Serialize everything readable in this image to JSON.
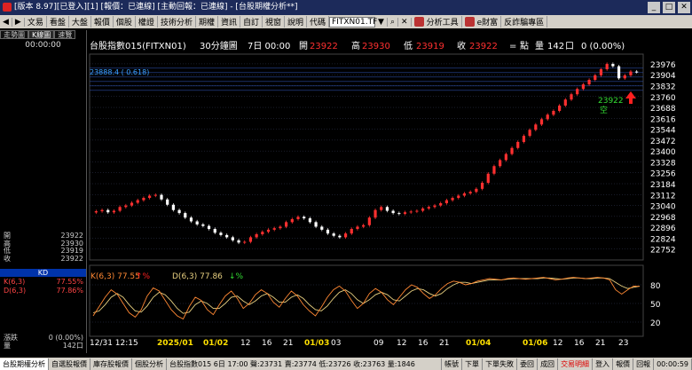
{
  "window": {
    "title": "[版本 8.97][已登入][1] [報價：已連線] [主動回報：已連線] - [台股期權分析**]"
  },
  "menu": {
    "items": [
      "文易",
      "看盤",
      "大盤",
      "報價",
      "個股",
      "權證",
      "技術分析",
      "期權",
      "資訊",
      "自訂",
      "視窗",
      "說明"
    ],
    "code_label": "代碼",
    "code_value": "FITXN01.TF",
    "tools": "分析工具",
    "ipro": "e財富",
    "rebate": "反詐騙專區"
  },
  "left": {
    "tabs": [
      "走勢圖",
      "K線圖",
      "速覽"
    ],
    "time": "00:00:00",
    "ohlc": [
      {
        "l": "開",
        "v": "23922"
      },
      {
        "l": "高",
        "v": "23930"
      },
      {
        "l": "低",
        "v": "23919"
      },
      {
        "l": "收",
        "v": "23922"
      }
    ],
    "kd_title": "KD",
    "k_label": "K(6,3)",
    "k_value": "77.55%",
    "d_label": "D(6,3)",
    "d_value": "77.86%",
    "chg_label": "漲跌",
    "chg_value": "0 (0.00%)",
    "vol_label": "量",
    "vol_value": "142口"
  },
  "header": {
    "name": "台股指數015(FITXN01)",
    "period": "30分鐘圖",
    "date": "7日 00:00",
    "open_l": "開",
    "open": "23922",
    "high_l": "高",
    "high": "23930",
    "low_l": "低",
    "low": "23919",
    "close_l": "收",
    "close": "23922",
    "eq": "=",
    "point": "點",
    "vol_l": "量",
    "vol": "142",
    "unit": "口",
    "pct": "0 (0.00%)"
  },
  "overlay": {
    "level_label": "23888.4 ( 0.618)",
    "last_price": "23922",
    "last_tag": "空"
  },
  "kd_header": {
    "k": "K(6,3) 77.55",
    "d": "D(6,3) 77.86"
  },
  "colors": {
    "up": "#ff3030",
    "down": "#ffffff",
    "k": "#ff8833",
    "d": "#e8d080",
    "grid": "#333a55",
    "accent": "#3aa0ff"
  },
  "chart_data": {
    "type": "candlestick",
    "price_axis": {
      "ticks": [
        "23976",
        "23904",
        "23832",
        "23760",
        "23688",
        "23616",
        "23544",
        "23472",
        "23400",
        "23328",
        "23256",
        "23184",
        "23112",
        "23040",
        "22968",
        "22896",
        "22824",
        "22752"
      ],
      "ylim": [
        22680,
        24040
      ]
    },
    "kd_axis": {
      "ticks": [
        "80",
        "50",
        "20"
      ],
      "ylim": [
        0,
        100
      ]
    },
    "x_labels": [
      "12/31 12:15",
      "2025/01",
      "01/02",
      "12",
      "16",
      "21",
      "01/03",
      "03",
      "09",
      "12",
      "16",
      "21",
      "01/04",
      "01/06",
      "12",
      "16",
      "21",
      "23"
    ],
    "fib_level": 23888.4,
    "close": [
      23002,
      23010,
      22995,
      23005,
      23030,
      23040,
      23058,
      23075,
      23090,
      23105,
      23110,
      23080,
      23045,
      23010,
      22990,
      22960,
      22935,
      22915,
      22905,
      22885,
      22860,
      22845,
      22830,
      22810,
      22795,
      22800,
      22830,
      22850,
      22866,
      22880,
      22890,
      22900,
      22930,
      22950,
      22965,
      22955,
      22930,
      22900,
      22880,
      22855,
      22840,
      22830,
      22855,
      22885,
      22900,
      22910,
      22960,
      23010,
      23030,
      23005,
      22990,
      22985,
      22995,
      23000,
      23005,
      23020,
      23030,
      23040,
      23055,
      23075,
      23090,
      23105,
      23120,
      23130,
      23150,
      23190,
      23250,
      23300,
      23340,
      23380,
      23420,
      23460,
      23500,
      23540,
      23575,
      23610,
      23640,
      23665,
      23700,
      23740,
      23775,
      23810,
      23840,
      23870,
      23900,
      23940,
      23975,
      23960,
      23880,
      23900,
      23925,
      23922
    ],
    "k": [
      30,
      45,
      60,
      72,
      65,
      50,
      35,
      28,
      40,
      62,
      75,
      70,
      55,
      40,
      30,
      25,
      45,
      60,
      55,
      40,
      32,
      48,
      62,
      70,
      58,
      42,
      50,
      64,
      72,
      66,
      52,
      44,
      58,
      70,
      62,
      48,
      38,
      30,
      44,
      60,
      72,
      78,
      70,
      55,
      42,
      50,
      66,
      74,
      68,
      56,
      48,
      60,
      72,
      80,
      76,
      66,
      58,
      64,
      74,
      82,
      86,
      84,
      80,
      82,
      86,
      88,
      90,
      89,
      88,
      90,
      91,
      90,
      89,
      90,
      91,
      92,
      90,
      88,
      89,
      91,
      92,
      91,
      90,
      91,
      92,
      91,
      88,
      72,
      65,
      72,
      78,
      77.55
    ],
    "d": [
      35,
      38,
      48,
      60,
      66,
      60,
      48,
      38,
      36,
      46,
      60,
      68,
      64,
      54,
      42,
      34,
      36,
      48,
      54,
      50,
      42,
      42,
      50,
      60,
      62,
      54,
      48,
      54,
      62,
      66,
      60,
      52,
      52,
      60,
      64,
      58,
      48,
      40,
      38,
      46,
      58,
      68,
      72,
      66,
      56,
      50,
      56,
      64,
      68,
      64,
      56,
      54,
      62,
      70,
      74,
      72,
      66,
      62,
      66,
      74,
      80,
      84,
      84,
      82,
      84,
      86,
      88,
      88,
      88,
      89,
      90,
      90,
      90,
      90,
      90,
      91,
      91,
      90,
      89,
      90,
      91,
      91,
      90,
      90,
      91,
      91,
      90,
      84,
      78,
      74,
      76,
      77.86
    ]
  },
  "status": {
    "tabs": [
      "台股期權分析",
      "自選股報價",
      "庫存股報價",
      "個股分析"
    ],
    "quote": "台股指數015 6日 17:00 聲:23731 賣:23774 低:23726 收:23763 量:1846",
    "buttons": [
      "帳號",
      "下單",
      "下單失敗",
      "委回",
      "成回",
      "交易明細",
      "登入",
      "報價",
      "回報"
    ],
    "time": "00:00:59"
  }
}
